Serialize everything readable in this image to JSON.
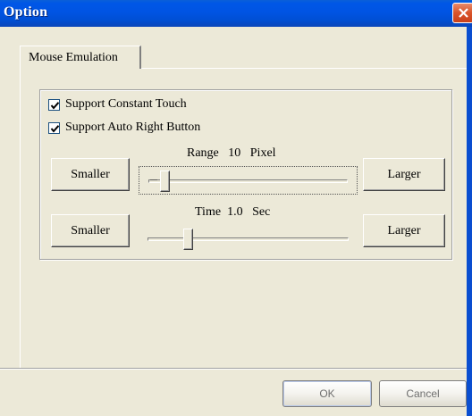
{
  "window": {
    "title": "Option",
    "close_icon": "close-x-icon"
  },
  "tabs": [
    {
      "label": "Mouse Emulation",
      "selected": true
    }
  ],
  "settings": {
    "checkboxes": [
      {
        "label": "Support Constant Touch",
        "checked": true
      },
      {
        "label": "Support Auto Right Button",
        "checked": true
      }
    ],
    "range": {
      "caption_prefix": "Range",
      "value": "10",
      "unit": "Pixel",
      "smaller_label": "Smaller",
      "larger_label": "Larger",
      "slider_position": 0.08
    },
    "time": {
      "caption_prefix": "Time",
      "value": "1.0",
      "unit": "Sec",
      "smaller_label": "Smaller",
      "larger_label": "Larger",
      "slider_position": 0.2
    }
  },
  "footer": {
    "ok_label": "OK",
    "cancel_label": "Cancel"
  }
}
